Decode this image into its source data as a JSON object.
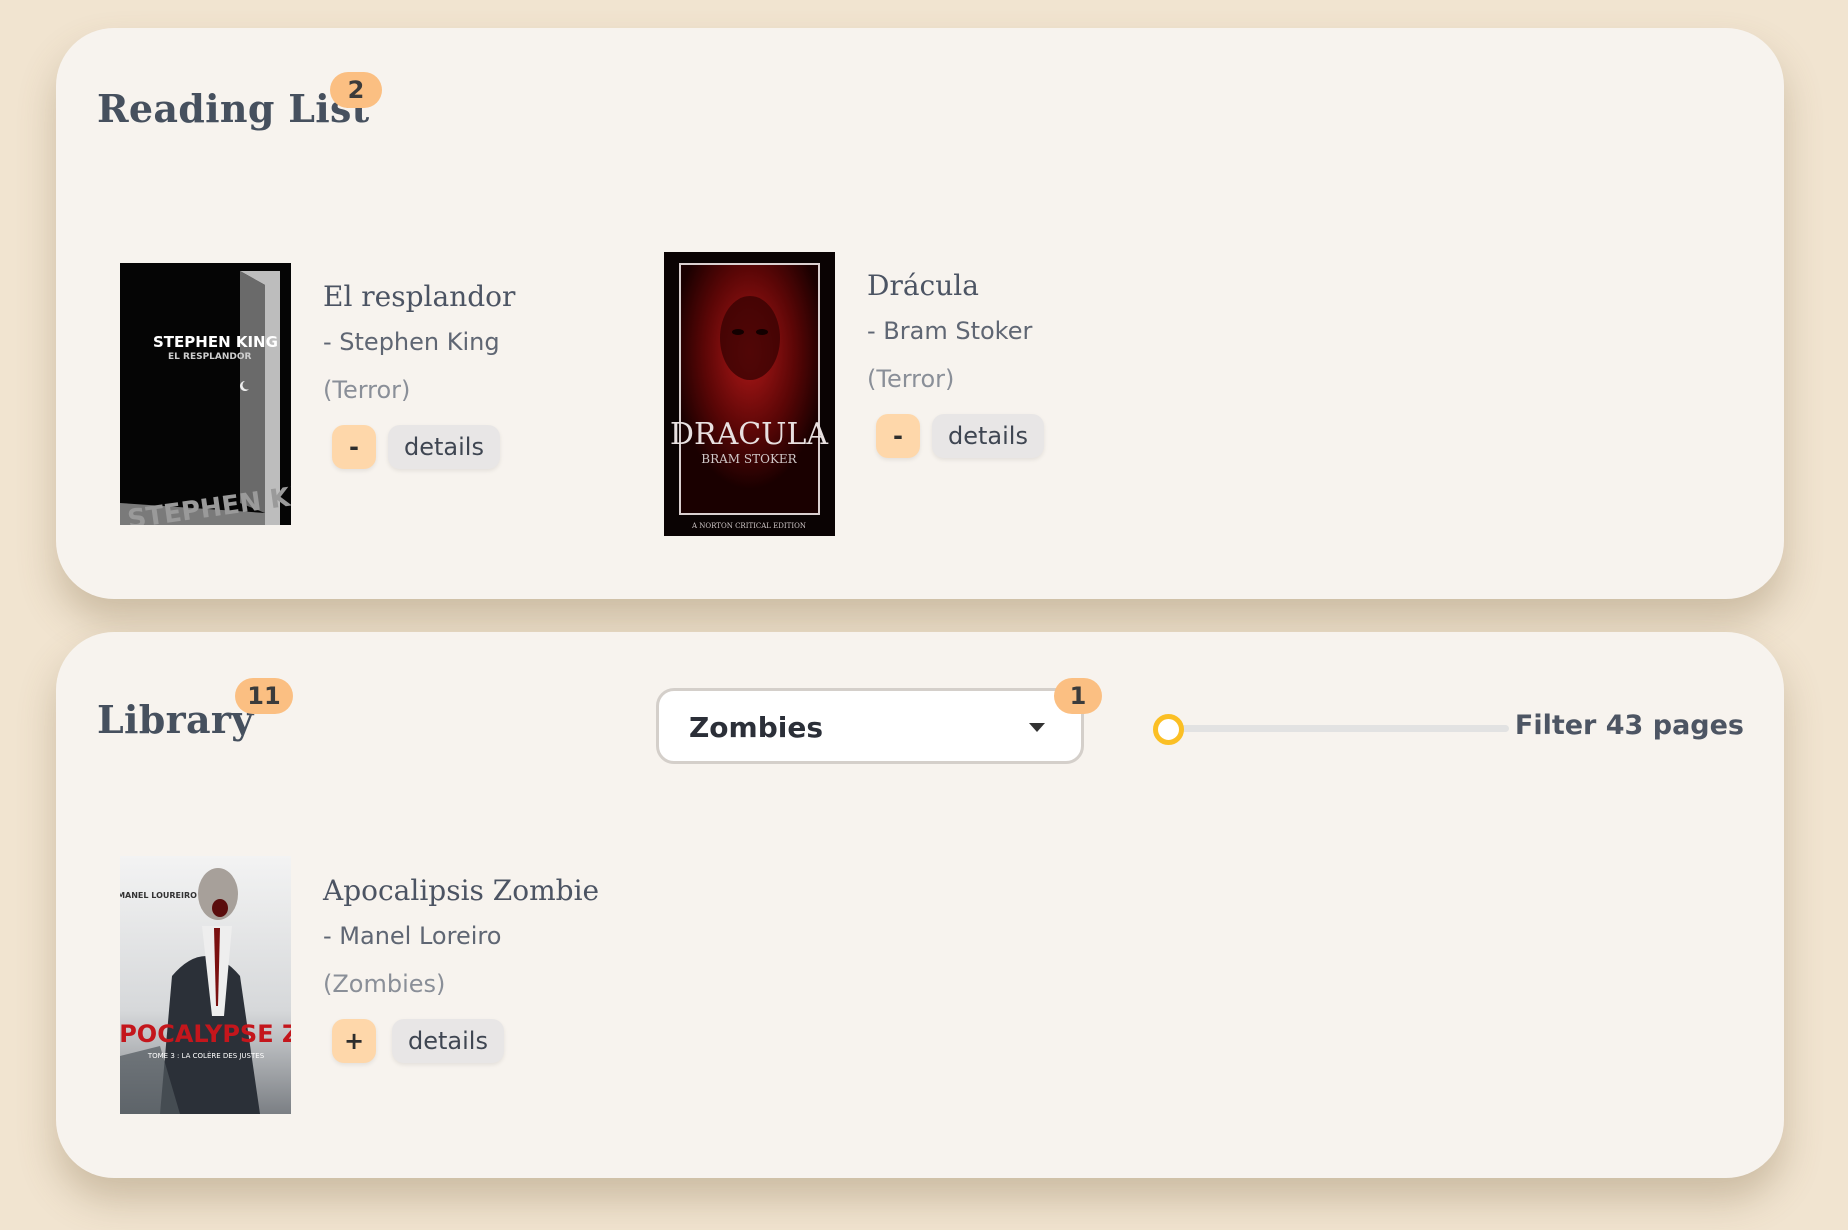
{
  "reading_list": {
    "title": "Reading List",
    "count": "2",
    "books": [
      {
        "title": "El resplandor",
        "author": "- Stephen King",
        "genre": "(Terror)",
        "toggle_label": "-",
        "details_label": "details",
        "cover_text": [
          "STEPHEN KING",
          "EL RESPLANDOR",
          "STEPHEN KING"
        ]
      },
      {
        "title": "Drácula",
        "author": "- Bram Stoker",
        "genre": "(Terror)",
        "toggle_label": "-",
        "details_label": "details",
        "cover_text": [
          "DRACULA",
          "BRAM STOKER",
          "A NORTON CRITICAL EDITION"
        ]
      }
    ]
  },
  "library": {
    "title": "Library",
    "count": "11",
    "genre_filter": {
      "selected": "Zombies",
      "count": "1"
    },
    "pages_slider": {
      "value_fraction": 0.0
    },
    "filter_label": "Filter 43 pages",
    "books": [
      {
        "title": "Apocalipsis Zombie",
        "author": "- Manel Loreiro",
        "genre": "(Zombies)",
        "toggle_label": "+",
        "details_label": "details",
        "cover_text": [
          "MANEL LOUREIRO",
          "APOCALYPSE Z",
          "TOME 3 : LA COLÈRE DES JUSTES"
        ]
      }
    ]
  },
  "colors": {
    "page_background": "#f1e4d0",
    "panel_background": "#f7f3ee",
    "badge": "#fbbf82",
    "toggle_button": "#fed7aa",
    "slider_thumb": "#fbbf24"
  }
}
